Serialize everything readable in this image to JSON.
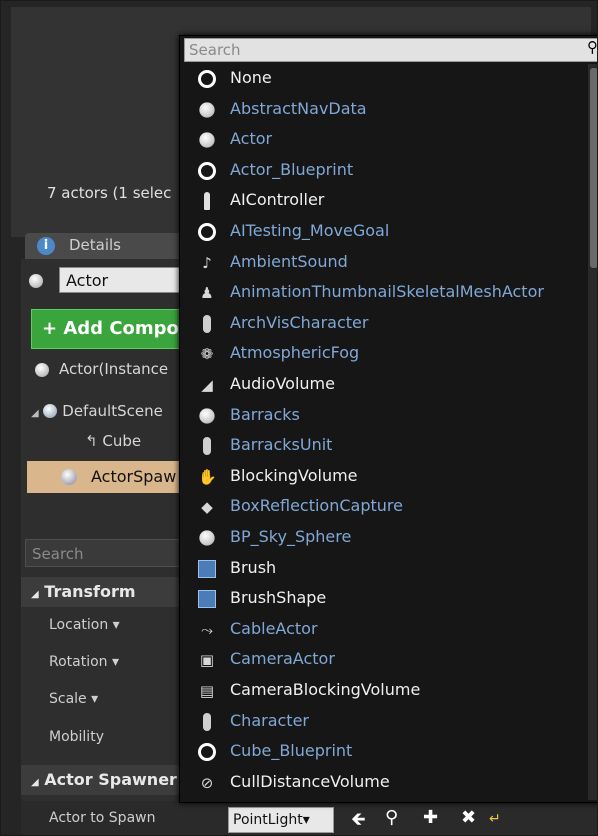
{
  "outliner": {
    "actors_count": "7 actors (1 selec"
  },
  "details": {
    "tab_label": "Details",
    "actor_name": "Actor",
    "add_component": "+ Add Compo",
    "instance_label": "Actor(Instance",
    "tree_root": "DefaultScene",
    "tree_cube": "Cube",
    "tree_spawn": "ActorSpaw",
    "search_placeholder": "Search",
    "transform_section": "Transform",
    "location": "Location ▾",
    "rotation": "Rotation ▾",
    "scale": "Scale ▾",
    "mobility": "Mobility",
    "spawner_section": "Actor Spawner",
    "actor_to_spawn": "Actor to Spawn",
    "spawn_value": "PointLight▾"
  },
  "dropdown": {
    "search_placeholder": "Search",
    "items": [
      {
        "label": "None",
        "icon": "ring",
        "color": "white"
      },
      {
        "label": "AbstractNavData",
        "icon": "sphere",
        "color": "blue"
      },
      {
        "label": "Actor",
        "icon": "sphere",
        "color": "blue"
      },
      {
        "label": "Actor_Blueprint",
        "icon": "ring",
        "color": "blue"
      },
      {
        "label": "AIController",
        "icon": "controller",
        "color": "white"
      },
      {
        "label": "AITesting_MoveGoal",
        "icon": "ring",
        "color": "blue"
      },
      {
        "label": "AmbientSound",
        "icon": "sound",
        "color": "blue"
      },
      {
        "label": "AnimationThumbnailSkeletalMeshActor",
        "icon": "figure",
        "color": "blue"
      },
      {
        "label": "ArchVisCharacter",
        "icon": "capsule",
        "color": "blue"
      },
      {
        "label": "AtmosphericFog",
        "icon": "fog",
        "color": "blue"
      },
      {
        "label": "AudioVolume",
        "icon": "audio-volume",
        "color": "white"
      },
      {
        "label": "Barracks",
        "icon": "sphere",
        "color": "blue"
      },
      {
        "label": "BarracksUnit",
        "icon": "capsule",
        "color": "blue"
      },
      {
        "label": "BlockingVolume",
        "icon": "hand",
        "color": "white"
      },
      {
        "label": "BoxReflectionCapture",
        "icon": "reflection",
        "color": "blue"
      },
      {
        "label": "BP_Sky_Sphere",
        "icon": "sphere",
        "color": "blue"
      },
      {
        "label": "Brush",
        "icon": "cube",
        "color": "white"
      },
      {
        "label": "BrushShape",
        "icon": "cube",
        "color": "white"
      },
      {
        "label": "CableActor",
        "icon": "cable",
        "color": "blue"
      },
      {
        "label": "CameraActor",
        "icon": "camera",
        "color": "blue"
      },
      {
        "label": "CameraBlockingVolume",
        "icon": "camera-volume",
        "color": "white"
      },
      {
        "label": "Character",
        "icon": "capsule",
        "color": "blue"
      },
      {
        "label": "Cube_Blueprint",
        "icon": "ring",
        "color": "blue"
      },
      {
        "label": "CullDistanceVolume",
        "icon": "cull",
        "color": "white"
      }
    ]
  },
  "colors": {
    "white_text": "#f0f0f0",
    "blue_text": "#80a8d6",
    "add_button": "#3aa43d",
    "selected_row": "#d9b68b"
  }
}
